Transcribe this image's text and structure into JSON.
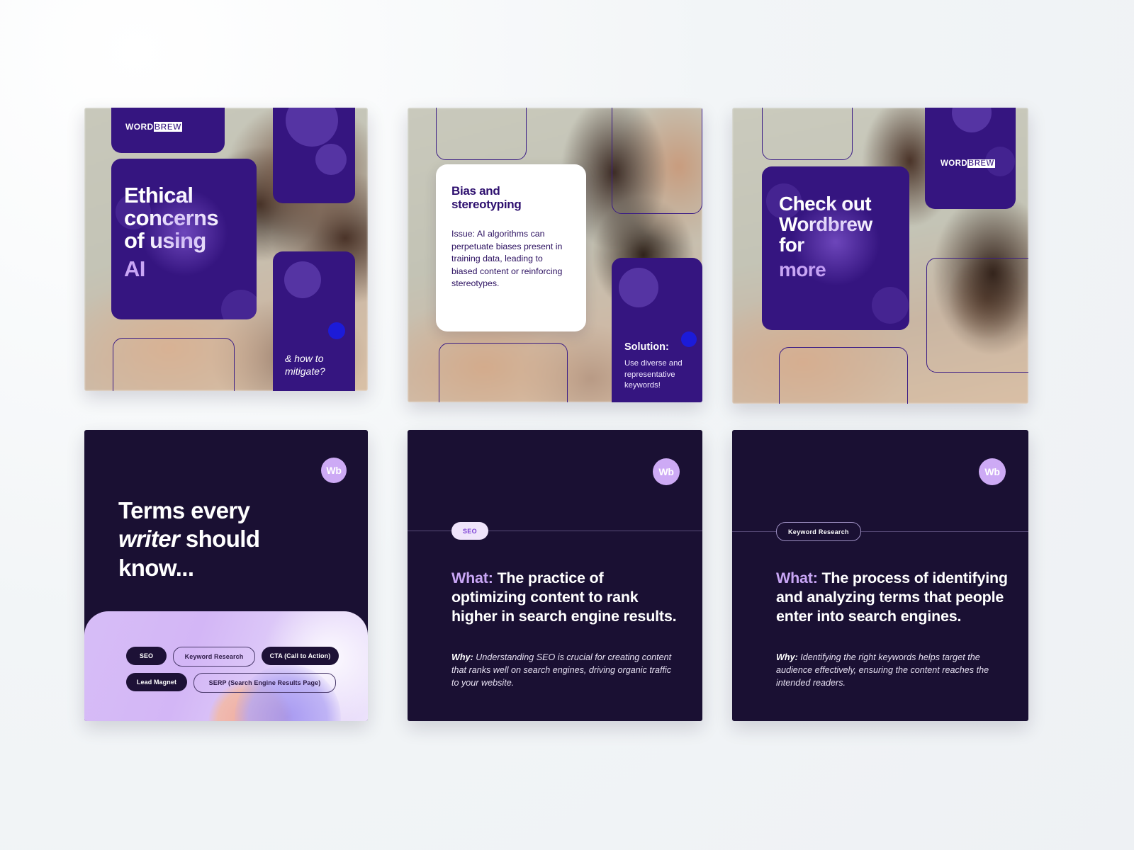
{
  "brand": {
    "logo_word": "WORD",
    "logo_brew": "BREW",
    "badge_text": "Wb",
    "accent_purple": "#351580",
    "accent_lavender": "#c9a6f5",
    "navy": "#1a1033"
  },
  "cards": {
    "card1": {
      "name": "Ethical concerns of using AI",
      "title_line1": "Ethical",
      "title_line2": "concerns",
      "title_line3": "of using",
      "title_highlight": "AI",
      "footnote_line1": "& how to",
      "footnote_line2": "mitigate?"
    },
    "card2": {
      "name": "Bias and stereotyping",
      "heading_line1": "Bias and",
      "heading_line2": "stereotyping",
      "body": "Issue: AI algorithms can perpetuate biases present in training data, leading to biased content or reinforcing stereotypes.",
      "solution_label": "Solution:",
      "solution_body": "Use diverse and representative keywords!"
    },
    "card3": {
      "name": "Check out Wordbrew for more",
      "title_line1": "Check out",
      "title_line2": "Wordbrew",
      "title_line3": "for",
      "title_highlight": "more"
    },
    "card4": {
      "name": "Terms every writer should know",
      "title_line1_a": "Terms every",
      "title_line2_italic": "writer",
      "title_line2_b": "should",
      "title_line3": "know...",
      "terms_row1": [
        "SEO",
        "Keyword Research",
        "CTA (Call to Action)"
      ],
      "terms_row2": [
        "Lead Magnet",
        "SERP (Search Engine Results Page)"
      ]
    },
    "card5": {
      "name": "SEO definition card",
      "tag": "SEO",
      "what_label": "What:",
      "what_text": "The practice of optimizing content to rank higher in search engine results.",
      "why_label": "Why:",
      "why_text": "Understanding SEO is crucial for creating content that ranks well on search engines, driving organic traffic to your website."
    },
    "card6": {
      "name": "Keyword Research definition card",
      "tag": "Keyword Research",
      "what_label": "What:",
      "what_text": "The process of identifying and analyzing terms that people enter into search engines.",
      "why_label": "Why:",
      "why_text": "Identifying the right keywords helps target the audience effectively, ensuring the content reaches the intended readers."
    }
  }
}
